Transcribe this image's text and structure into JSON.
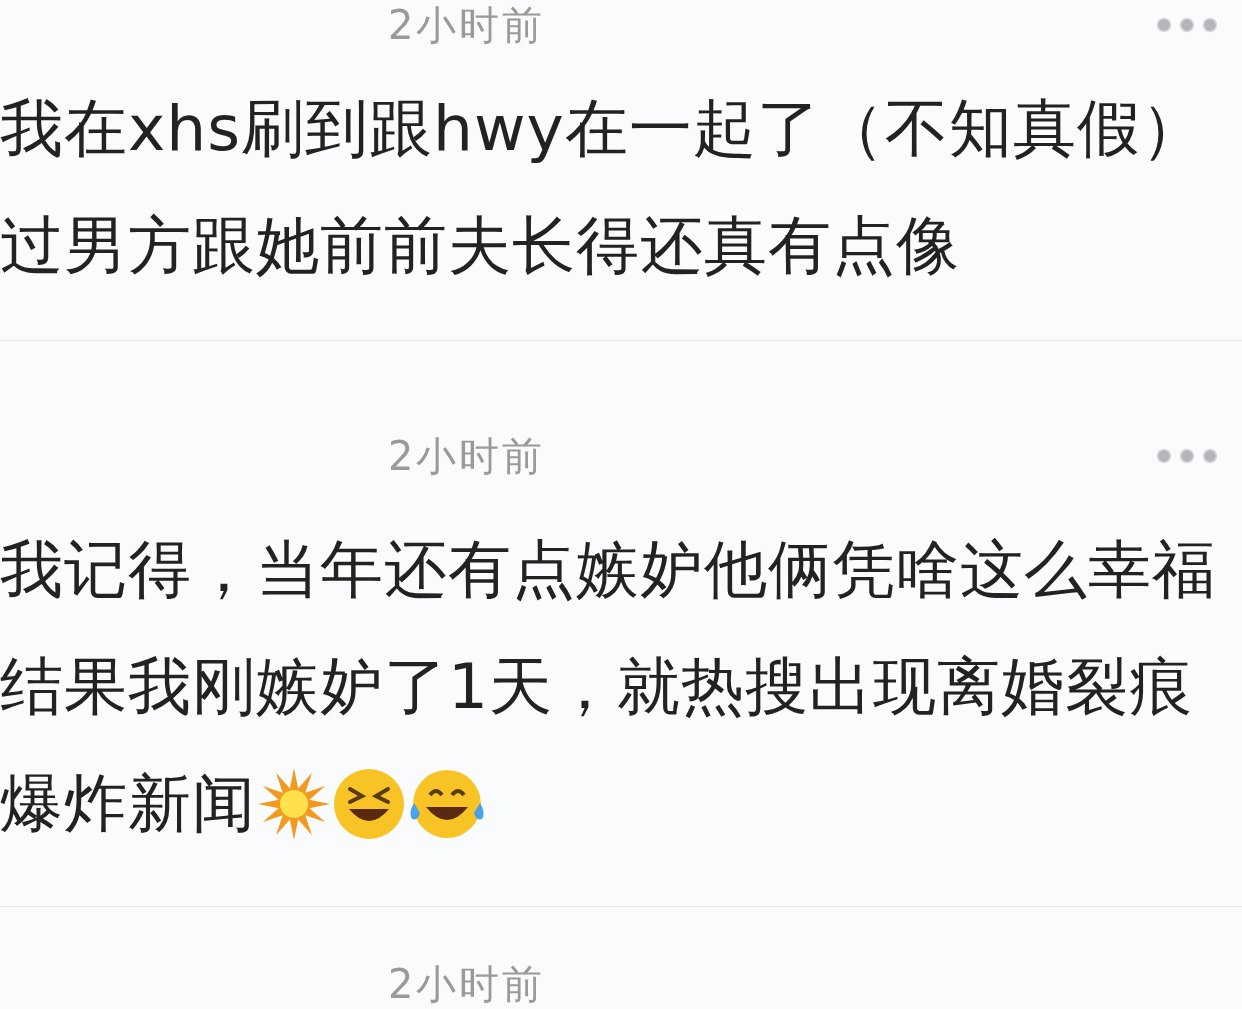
{
  "comments": [
    {
      "time": "2小时前",
      "menu": true,
      "lines": [
        {
          "text": "我在xhs刷到跟hwy在一起了（不知真假）"
        },
        {
          "text": "过男方跟她前前夫长得还真有点像"
        }
      ]
    },
    {
      "time": "2小时前",
      "menu": true,
      "lines": [
        {
          "text": "我记得，当年还有点嫉妒他俩凭啥这么幸福"
        },
        {
          "text": "结果我刚嫉妒了1天，就热搜出现离婚裂痕"
        },
        {
          "text": "爆炸新闻",
          "emoji": [
            {
              "kind": "collision"
            },
            {
              "kind": "squint-laugh"
            },
            {
              "kind": "tears-of-joy"
            }
          ]
        }
      ]
    },
    {
      "time": "2小时前",
      "menu": false
    }
  ]
}
